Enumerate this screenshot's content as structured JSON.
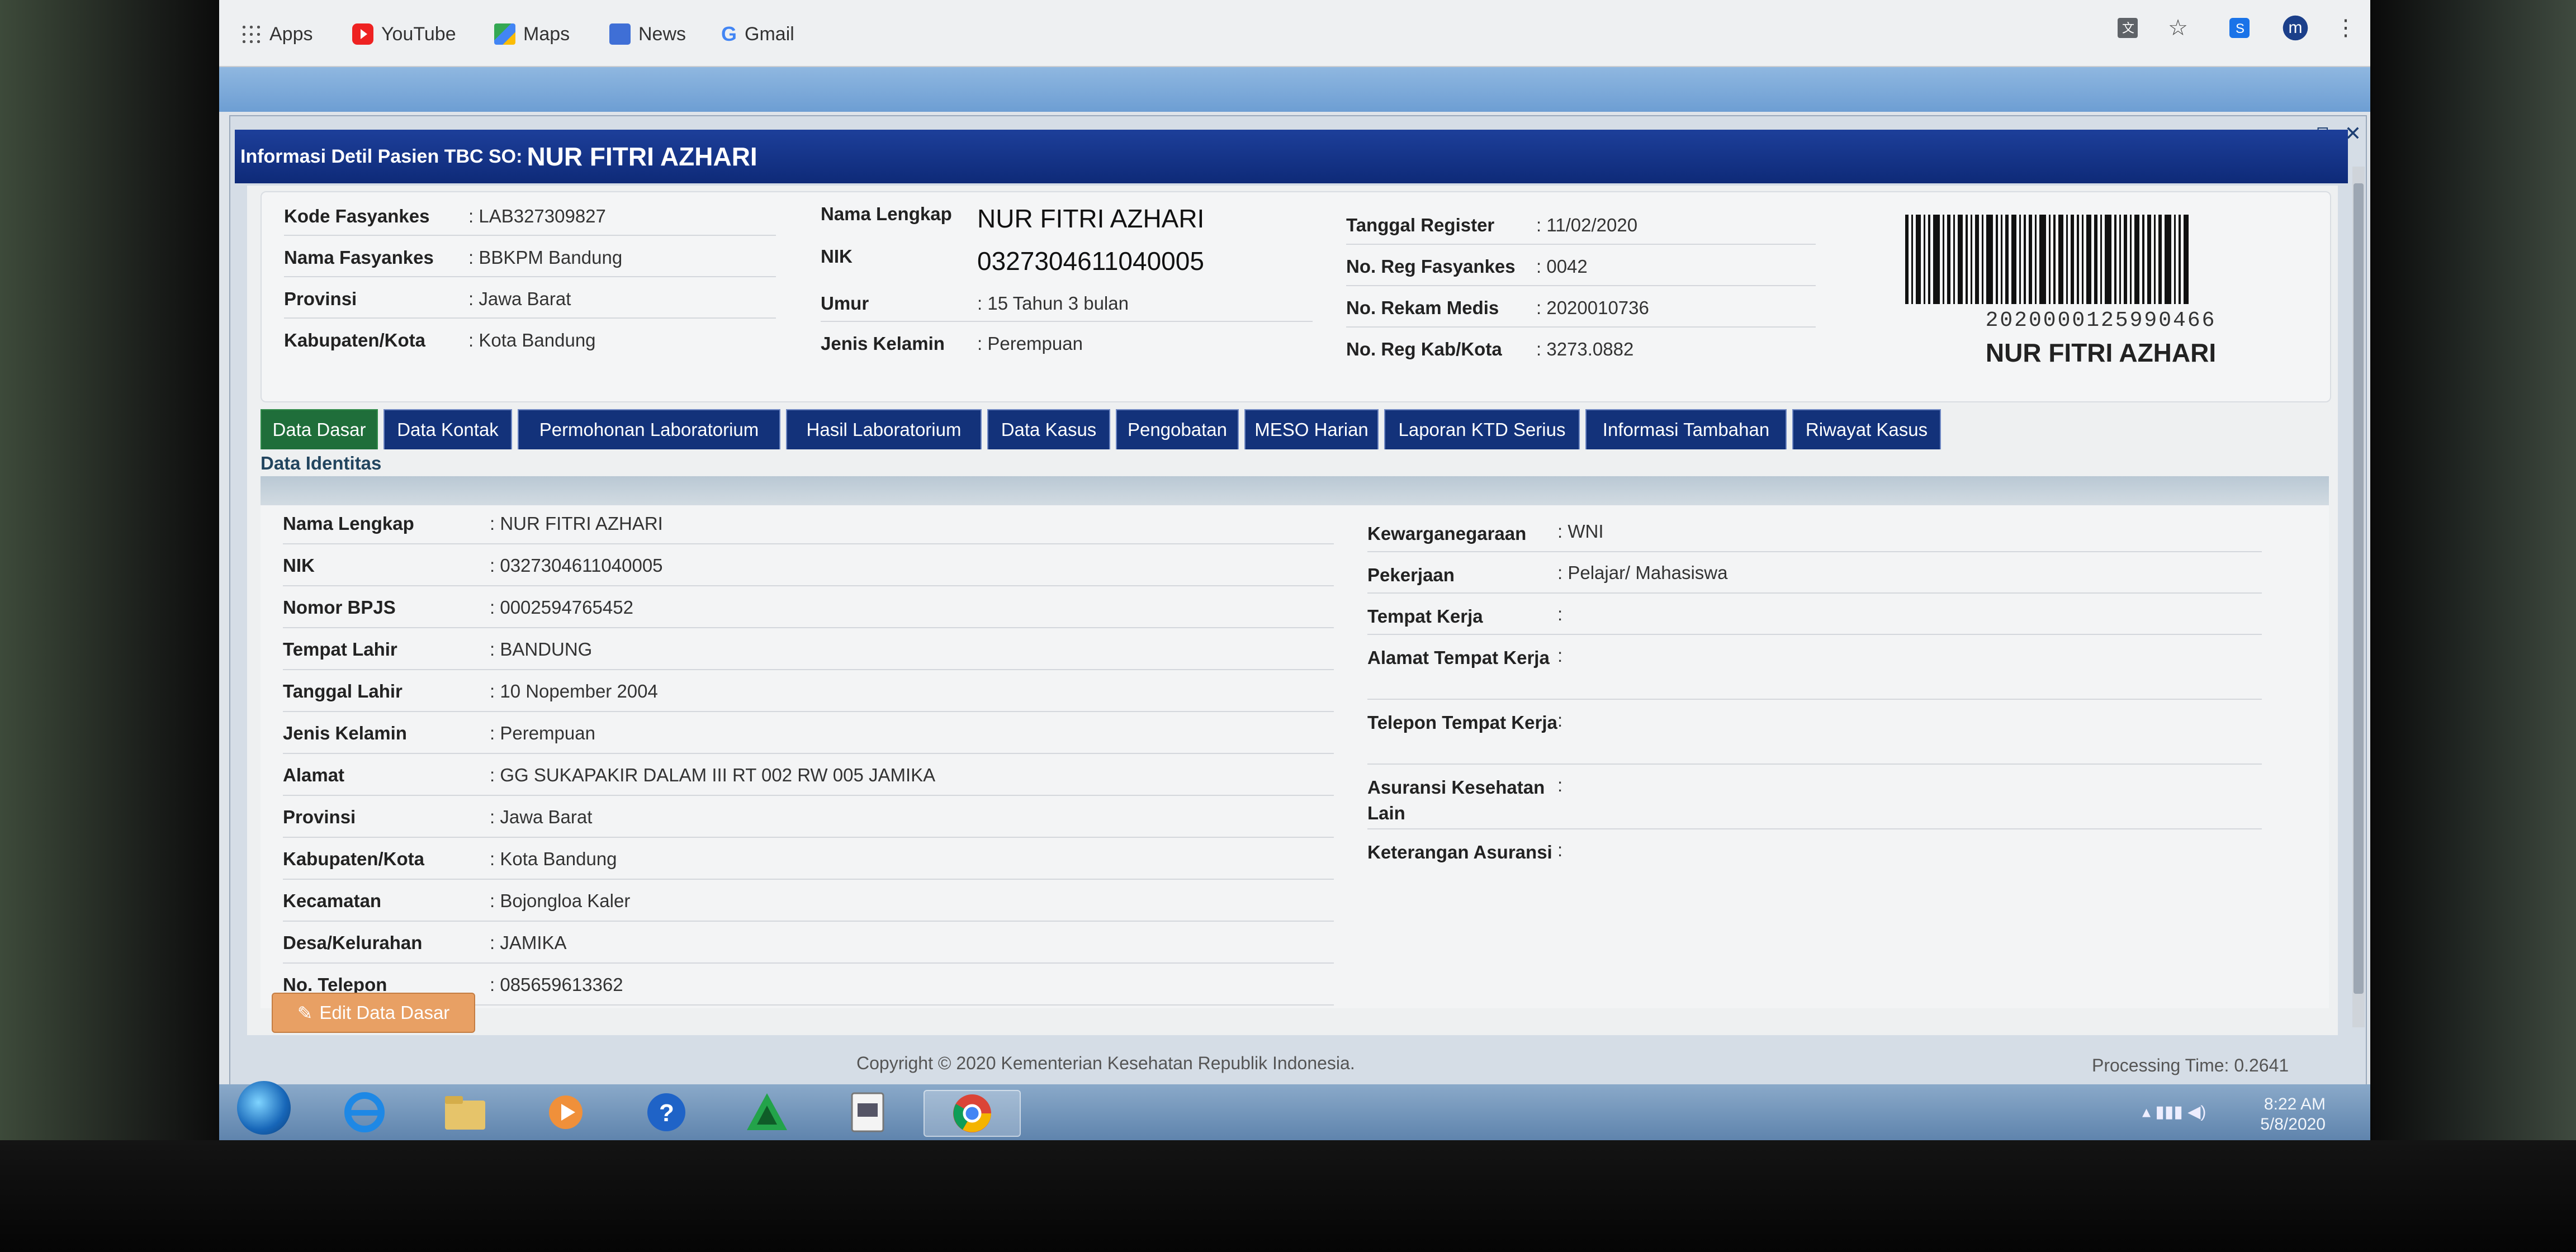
{
  "browser": {
    "bookmarks": [
      {
        "label": "Apps",
        "icon": "apps-grid-icon"
      },
      {
        "label": "YouTube",
        "icon": "youtube-icon"
      },
      {
        "label": "Maps",
        "icon": "maps-icon"
      },
      {
        "label": "News",
        "icon": "news-icon"
      },
      {
        "label": "Gmail",
        "icon": "google-icon"
      }
    ],
    "profile_initial": "m"
  },
  "window": {
    "title_prefix": "Informasi Detil Pasien TBC SO:",
    "title_name": "NUR FITRI AZHARI"
  },
  "summary": {
    "col1": [
      {
        "label": "Kode Fasyankes",
        "value": ": LAB327309827"
      },
      {
        "label": "Nama Fasyankes",
        "value": ": BBKPM Bandung"
      },
      {
        "label": "Provinsi",
        "value": ": Jawa Barat"
      },
      {
        "label": "Kabupaten/Kota",
        "value": ": Kota Bandung"
      }
    ],
    "col2": [
      {
        "label": "Nama Lengkap",
        "value": "NUR FITRI AZHARI"
      },
      {
        "label": "NIK",
        "value": "0327304611040005"
      },
      {
        "label": "Umur",
        "value": ": 15 Tahun 3 bulan"
      },
      {
        "label": "Jenis Kelamin",
        "value": ": Perempuan"
      }
    ],
    "col3": [
      {
        "label": "Tanggal Register",
        "value": ": 11/02/2020"
      },
      {
        "label": "No. Reg Fasyankes",
        "value": ": 0042"
      },
      {
        "label": "No. Rekam Medis",
        "value": ": 2020010736"
      },
      {
        "label": "No. Reg Kab/Kota",
        "value": ": 3273.0882"
      }
    ],
    "barcode_number": "2020000125990466",
    "barcode_name": "NUR FITRI AZHARI"
  },
  "tabs": [
    "Data Dasar",
    "Data Kontak",
    "Permohonan Laboratorium",
    "Hasil Laboratorium",
    "Data Kasus",
    "Pengobatan",
    "MESO Harian",
    "Laporan KTD Serius",
    "Informasi Tambahan",
    "Riwayat Kasus"
  ],
  "section_title": "Data Identitas",
  "identity_left": [
    {
      "label": "Nama Lengkap",
      "value": ": NUR FITRI AZHARI"
    },
    {
      "label": "NIK",
      "value": ": 0327304611040005"
    },
    {
      "label": "Nomor BPJS",
      "value": ": 0002594765452"
    },
    {
      "label": "Tempat Lahir",
      "value": ": BANDUNG"
    },
    {
      "label": "Tanggal Lahir",
      "value": ": 10 Nopember 2004"
    },
    {
      "label": "Jenis Kelamin",
      "value": ": Perempuan"
    },
    {
      "label": "Alamat",
      "value": ": GG SUKAPAKIR DALAM III RT 002 RW 005 JAMIKA"
    },
    {
      "label": "Provinsi",
      "value": ": Jawa Barat"
    },
    {
      "label": "Kabupaten/Kota",
      "value": ": Kota Bandung"
    },
    {
      "label": "Kecamatan",
      "value": ": Bojongloa Kaler"
    },
    {
      "label": "Desa/Kelurahan",
      "value": ": JAMIKA"
    },
    {
      "label": "No. Telepon",
      "value": ": 085659613362"
    }
  ],
  "identity_right": [
    {
      "label": "Kewarganegaraan",
      "value": ": WNI"
    },
    {
      "label": "Pekerjaan",
      "value": ": Pelajar/ Mahasiswa"
    },
    {
      "label": "Tempat Kerja",
      "value": ":"
    },
    {
      "label": "Alamat Tempat Kerja",
      "value": ":"
    },
    {
      "label": "Telepon Tempat Kerja",
      "value": ":"
    },
    {
      "label": "Asuransi Kesehatan Lain",
      "value": ":"
    },
    {
      "label": "Keterangan Asuransi",
      "value": ":"
    }
  ],
  "edit_button": "Edit Data Dasar",
  "footer": {
    "copyright": "Copyright © 2020 Kementerian Kesehatan Republik Indonesia.",
    "processing": "Processing Time: 0.2641"
  },
  "taskbar": {
    "time": "8:22 AM",
    "date": "5/8/2020"
  },
  "colors": {
    "tab_bg": "#13327a",
    "tab_active_bg": "#1f6e3a",
    "title_bar": "#1d3f9a",
    "edit_button": "#e8a064"
  }
}
